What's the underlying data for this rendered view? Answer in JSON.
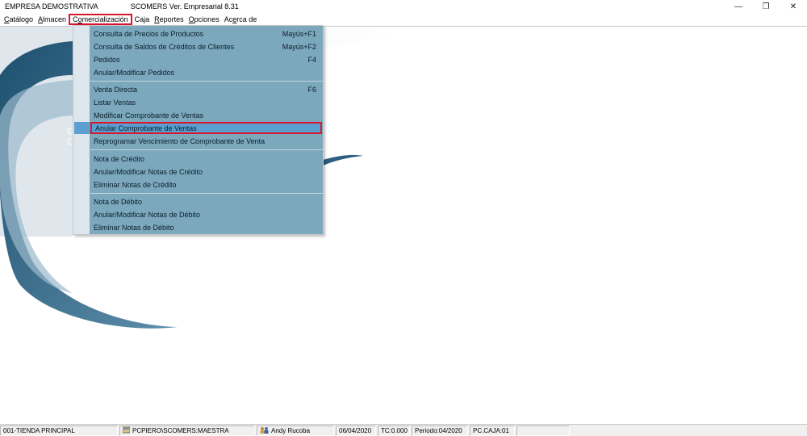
{
  "window": {
    "company": "EMPRESA DEMOSTRATIVA",
    "product": "SCOMERS Ver. Empresarial  8.31",
    "controls": {
      "minimize": "—",
      "restore": "❐",
      "close": "✕"
    }
  },
  "menubar": {
    "items": [
      {
        "label": "Catálogo",
        "accel": "C",
        "rest": "atálogo"
      },
      {
        "label": "Almacen",
        "accel": "A",
        "rest": "lmacen"
      },
      {
        "label": "Comercialización",
        "pre": "C",
        "accel": "o",
        "rest": "mercialización"
      },
      {
        "label": "Caja",
        "accel": "",
        "rest": "Caja"
      },
      {
        "label": "Reportes",
        "accel": "R",
        "rest": "eportes"
      },
      {
        "label": "Opciones",
        "accel": "O",
        "rest": "pciones"
      },
      {
        "label": "Acerca de",
        "pre": "Ac",
        "accel": "e",
        "rest": "rca de"
      }
    ]
  },
  "dropdown": {
    "items": [
      {
        "label": "Consulta de Precios de Productos",
        "shortcut": "Mayús+F1"
      },
      {
        "label": "Consulta de Saldos de Créditos de Clientes",
        "shortcut": "Mayús+F2"
      },
      {
        "label": "Pedidos",
        "shortcut": "F4"
      },
      {
        "label": "Anular/Modificar Pedidos",
        "shortcut": ""
      },
      {
        "label": "Venta Directa",
        "shortcut": "F6"
      },
      {
        "label": "Listar Ventas",
        "shortcut": ""
      },
      {
        "label": "Modificar Comprobante de Ventas",
        "shortcut": ""
      },
      {
        "label": "Anular Comprobante de Ventas",
        "shortcut": ""
      },
      {
        "label": "Reprogramar Vencimiento de Comprobante de Venta",
        "shortcut": ""
      },
      {
        "label": "Nota de Crédito",
        "shortcut": ""
      },
      {
        "label": "Anular/Modificar Notas de Crédito",
        "shortcut": ""
      },
      {
        "label": "Eliminar Notas de Crédito",
        "shortcut": ""
      },
      {
        "label": "Nota de Débito",
        "shortcut": ""
      },
      {
        "label": "Anular/Modificar Notas de Débito",
        "shortcut": ""
      },
      {
        "label": "Eliminar Notas de Débito",
        "shortcut": ""
      }
    ]
  },
  "statusbar": {
    "store": "001-TIENDA PRINCIPAL",
    "database": "PCPIERO\\SCOMERS:MAESTRA",
    "user": "Andy Rucoba",
    "date": "06/04/2020",
    "exchange": "TC:0.000",
    "period": "Periodo:04/2020",
    "terminal": "PC.CAJA:01"
  },
  "colors": {
    "menu_bg": "#7ba8bd",
    "highlight": "#5b9ed0",
    "annotation": "#d9162c"
  }
}
